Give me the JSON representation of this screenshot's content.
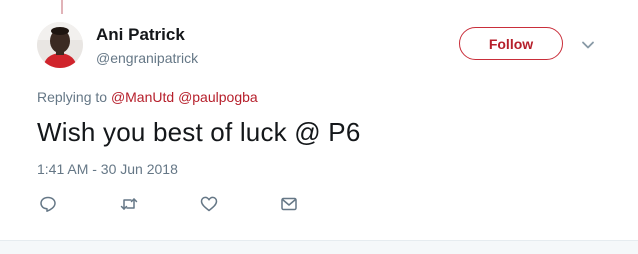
{
  "colors": {
    "accent": "#b61f2b",
    "secondary_text": "#657786",
    "primary_text": "#14171a"
  },
  "author": {
    "name": "Ani Patrick",
    "handle": "@engranipatrick",
    "avatar_icon": "user-avatar"
  },
  "header": {
    "follow_label": "Follow",
    "more_icon": "chevron-down-icon"
  },
  "reply_context": {
    "prefix": "Replying to",
    "mentions": [
      "@ManUtd",
      "@paulpogba"
    ]
  },
  "tweet": {
    "text": "Wish you best of luck @ P6",
    "timestamp": "1:41 AM - 30 Jun 2018"
  },
  "actions": [
    {
      "name": "reply",
      "icon": "reply-icon"
    },
    {
      "name": "retweet",
      "icon": "retweet-icon"
    },
    {
      "name": "like",
      "icon": "heart-icon"
    },
    {
      "name": "direct-message",
      "icon": "envelope-icon"
    }
  ]
}
